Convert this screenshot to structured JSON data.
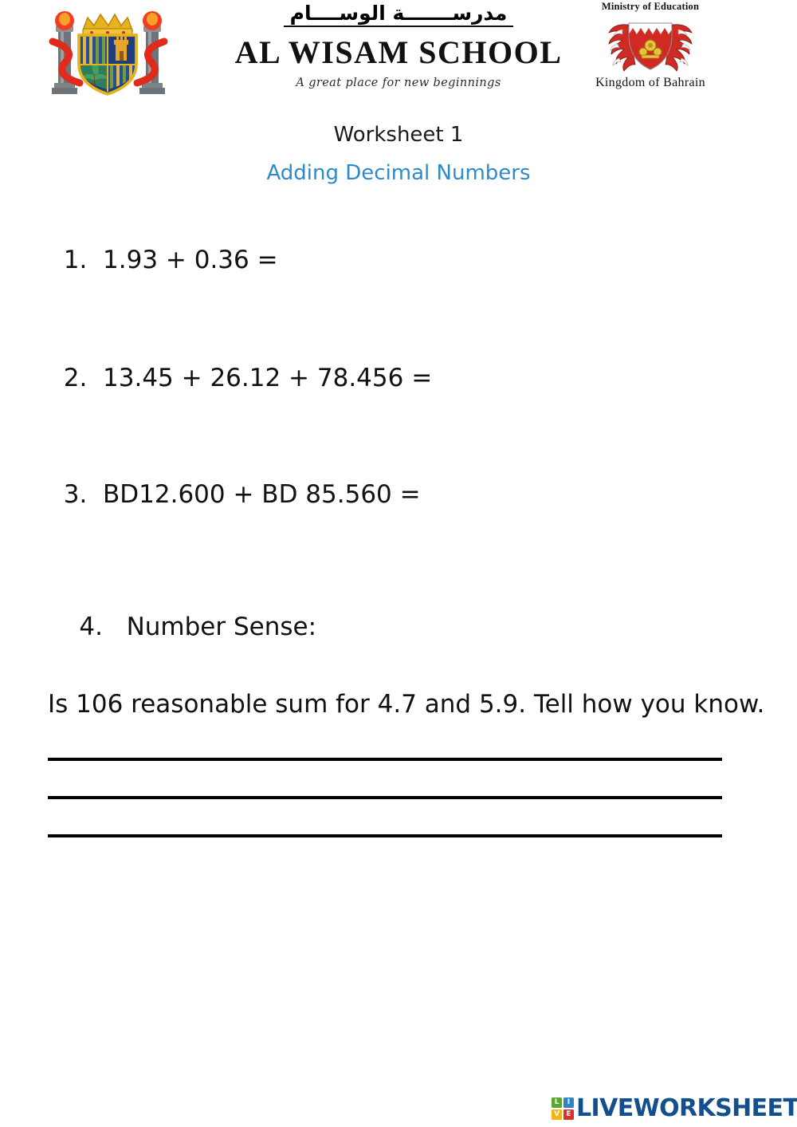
{
  "header": {
    "school_crest_alt": "Al Wisam School crest",
    "school_name_arabic": "مدرســـــــة الوســــام",
    "school_name_english": "AL WISAM SCHOOL",
    "school_motto": "A great place for new beginnings",
    "ministry_top_text": "Ministry of Education",
    "ministry_bottom_text": "Kingdom of Bahrain"
  },
  "worksheet": {
    "title": "Worksheet 1",
    "subtitle": "Adding Decimal Numbers",
    "subtitle_color": "#2e8bc8",
    "questions": [
      {
        "number": "1.",
        "text": "1.93 + 0.36 ="
      },
      {
        "number": "2.",
        "text": "13.45 + 26.12 + 78.456 ="
      },
      {
        "number": "3.",
        "text": "BD12.600 + BD 85.560 ="
      }
    ],
    "question4": {
      "number": "4.",
      "heading": "Number Sense:",
      "body": "Is 106 reasonable sum for 4.7 and 5.9. Tell how you know."
    },
    "answer_lines_count": 3
  },
  "footer": {
    "brand_word": "LIVEWORKSHEETS",
    "brand_color": "#134f8c",
    "mark_letters": [
      {
        "letter": "L",
        "color": "#5aa832"
      },
      {
        "letter": "I",
        "color": "#2f86c5"
      },
      {
        "letter": "V",
        "color": "#f2b417"
      },
      {
        "letter": "E",
        "color": "#d8312b"
      }
    ]
  }
}
